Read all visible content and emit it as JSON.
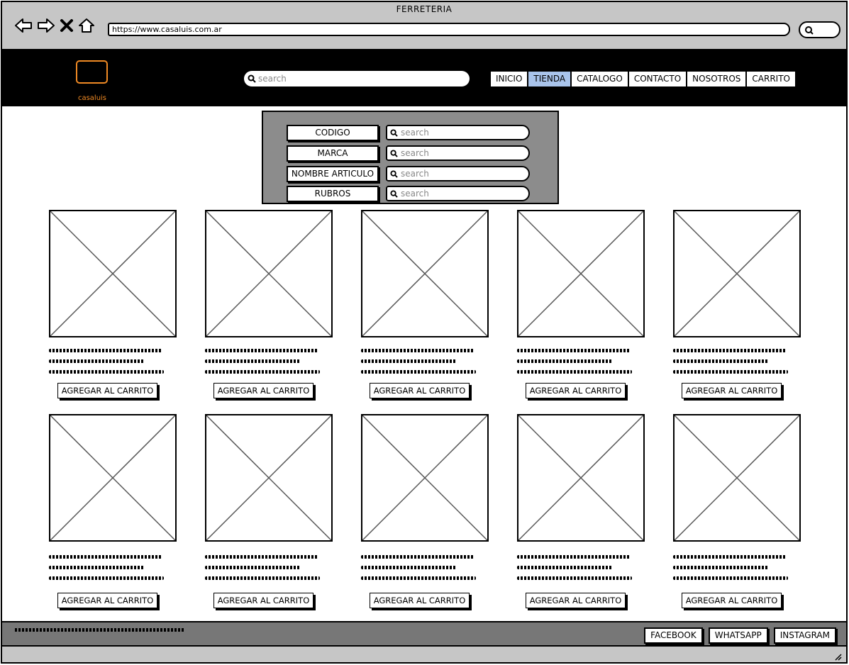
{
  "window": {
    "title": "FERRETERIA"
  },
  "browser": {
    "url": "https://www.casaluis.com.ar"
  },
  "header": {
    "logo_text": "casaluis",
    "search_placeholder": "search",
    "nav": [
      {
        "label": "INICIO",
        "active": false
      },
      {
        "label": "TIENDA",
        "active": true
      },
      {
        "label": "CATALOGO",
        "active": false
      },
      {
        "label": "CONTACTO",
        "active": false
      },
      {
        "label": "NOSOTROS",
        "active": false
      },
      {
        "label": "CARRITO",
        "active": false
      }
    ]
  },
  "filters": [
    {
      "label": "CODIGO",
      "placeholder": "search"
    },
    {
      "label": "MARCA",
      "placeholder": "search"
    },
    {
      "label": "NOMBRE ARTICULO",
      "placeholder": "search"
    },
    {
      "label": "RUBROS",
      "placeholder": "search"
    }
  ],
  "product_button_label": "AGREGAR AL CARRITO",
  "footer": {
    "links": [
      "FACEBOOK",
      "WHATSAPP",
      "INSTAGRAM"
    ]
  },
  "colors": {
    "accent_logo": "#f08a24",
    "active_nav": "#a9c4eb",
    "filter_panel": "#8c8c8c",
    "footer": "#777777"
  }
}
